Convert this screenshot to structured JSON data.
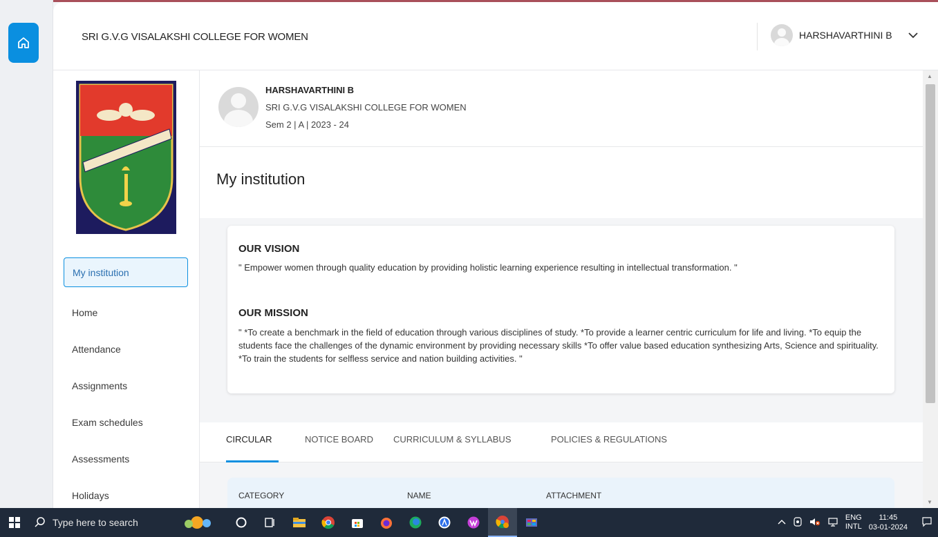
{
  "header": {
    "college_name": "SRI G.V.G VISALAKSHI COLLEGE FOR WOMEN",
    "user_name": "HARSHAVARTHINI B"
  },
  "profile": {
    "name": "HARSHAVARTHINI B",
    "college": "SRI G.V.G VISALAKSHI COLLEGE FOR WOMEN",
    "semester": "Sem 2 | A | 2023 - 24"
  },
  "sidebar": {
    "items": [
      {
        "label": "My institution",
        "active": true
      },
      {
        "label": "Home"
      },
      {
        "label": "Attendance"
      },
      {
        "label": "Assignments"
      },
      {
        "label": "Exam schedules"
      },
      {
        "label": "Assessments"
      },
      {
        "label": "Holidays"
      }
    ]
  },
  "main": {
    "page_title": "My institution",
    "vision_heading": "OUR VISION",
    "vision_text": "\" Empower women through quality education by providing holistic learning experience resulting in intellectual transformation. \"",
    "mission_heading": "OUR MISSION",
    "mission_text": "\" *To create a benchmark in the field of education through various disciplines of study. *To provide a learner centric curriculum for life and living. *To equip the students face the challenges of the dynamic environment by providing necessary skills *To offer value based education synthesizing Arts, Science and spirituality. *To train the students for selfless service and nation building activities. \"",
    "tabs": [
      {
        "label": "CIRCULAR",
        "active": true
      },
      {
        "label": "NOTICE BOARD"
      },
      {
        "label": "CURRICULUM & SYLLABUS"
      },
      {
        "label": "POLICIES & REGULATIONS"
      }
    ],
    "table_columns": [
      "CATEGORY",
      "NAME",
      "ATTACHMENT"
    ]
  },
  "taskbar": {
    "search_placeholder": "Type here to search",
    "lang_top": "ENG",
    "lang_bottom": "INTL",
    "time": "11:45",
    "date": "03-01-2024"
  },
  "colors": {
    "accent": "#0a8fe0",
    "taskbar": "#1f2a3a"
  }
}
